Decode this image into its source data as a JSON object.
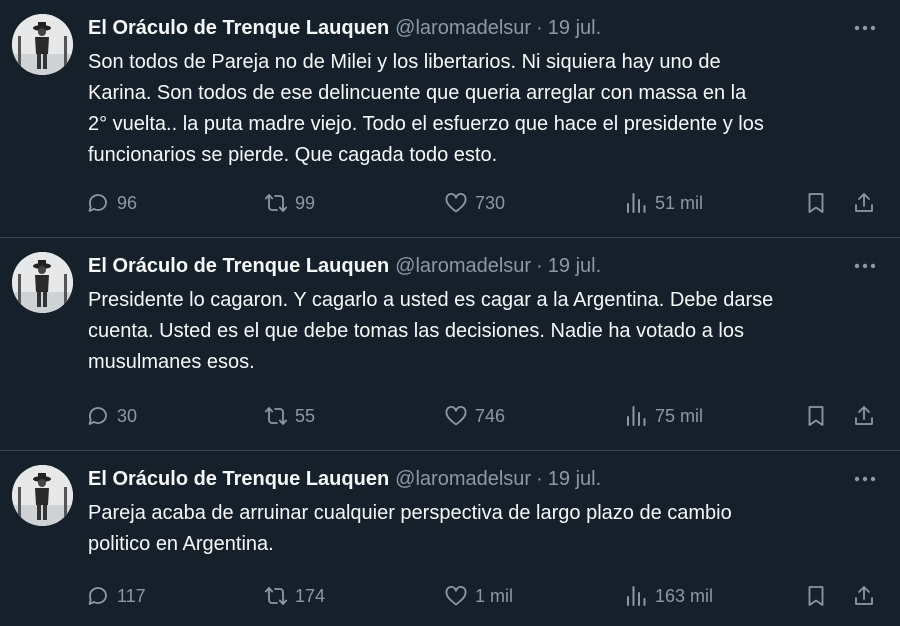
{
  "tweets": [
    {
      "author": "El Oráculo de Trenque Lauquen",
      "handle": "@laromadelsur",
      "separator": "·",
      "date": "19 jul.",
      "lines": [
        "Son todos de Pareja no de Milei y los libertarios. Ni siquiera hay uno de",
        "Karina. Son todos de ese delincuente que queria arreglar con massa en la",
        "2° vuelta.. la puta madre viejo. Todo el esfuerzo que hace el presidente y los",
        "funcionarios se pierde. Que cagada todo esto."
      ],
      "replies": "96",
      "retweets": "99",
      "likes": "730",
      "views": "51 mil"
    },
    {
      "author": "El Oráculo de Trenque Lauquen",
      "handle": "@laromadelsur",
      "separator": "·",
      "date": "19 jul.",
      "lines": [
        "Presidente lo cagaron. Y cagarlo a usted es cagar a la Argentina. Debe darse",
        "cuenta. Usted es el que debe tomas las decisiones. Nadie ha votado a los",
        "musulmanes esos."
      ],
      "replies": "30",
      "retweets": "55",
      "likes": "746",
      "views": "75 mil"
    },
    {
      "author": "El Oráculo de Trenque Lauquen",
      "handle": "@laromadelsur",
      "separator": "·",
      "date": "19 jul.",
      "lines": [
        "Pareja acaba de arruinar cualquier perspectiva de largo plazo de cambio",
        "politico en Argentina."
      ],
      "replies": "117",
      "retweets": "174",
      "likes": "1 mil",
      "views": "163 mil"
    }
  ],
  "icons": {
    "more": "more-dots-icon",
    "reply": "reply-icon",
    "retweet": "retweet-icon",
    "like": "heart-icon",
    "views": "views-icon",
    "bookmark": "bookmark-icon",
    "share": "share-icon"
  },
  "colors": {
    "background": "#15202b",
    "text": "#f7f9f9",
    "secondary": "#8b98a5",
    "divider": "#38444d"
  }
}
